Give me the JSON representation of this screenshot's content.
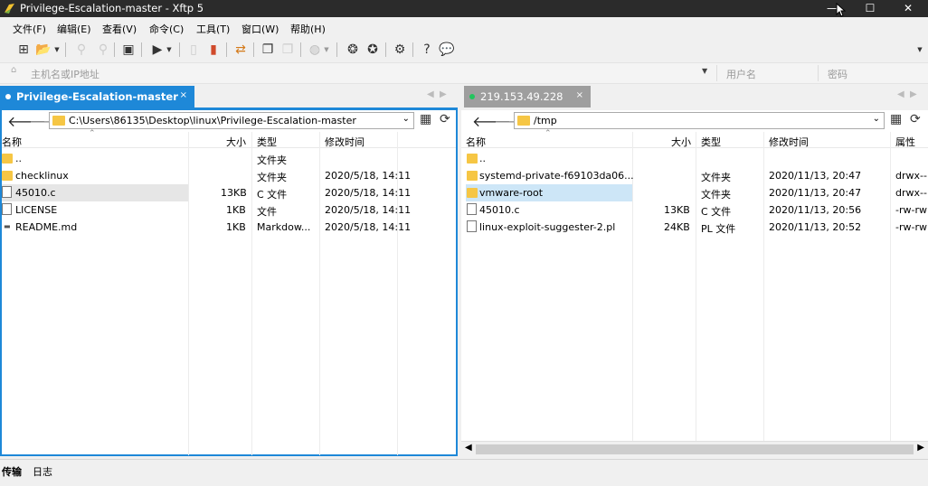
{
  "window": {
    "title": "Privilege-Escalation-master - Xftp 5"
  },
  "menu": [
    "文件(F)",
    "编辑(E)",
    "查看(V)",
    "命令(C)",
    "工具(T)",
    "窗口(W)",
    "帮助(H)"
  ],
  "address": {
    "host_placeholder": "主机名或IP地址",
    "user_placeholder": "用户名",
    "password_placeholder": "密码"
  },
  "tabs": {
    "local": {
      "label": "Privilege-Escalation-master",
      "close": "×"
    },
    "remote": {
      "label": "219.153.49.228",
      "close": "×"
    }
  },
  "local": {
    "path": "C:\\Users\\86135\\Desktop\\linux\\Privilege-Escalation-master",
    "columns": {
      "name": "名称",
      "size": "大小",
      "type": "类型",
      "modified": "修改时间"
    },
    "rows": [
      {
        "name": "..",
        "size": "",
        "type": "文件夹",
        "modified": "",
        "icon": "folder"
      },
      {
        "name": "checklinux",
        "size": "",
        "type": "文件夹",
        "modified": "2020/5/18, 14:11",
        "icon": "folder"
      },
      {
        "name": "45010.c",
        "size": "13KB",
        "type": "C 文件",
        "modified": "2020/5/18, 14:11",
        "icon": "file"
      },
      {
        "name": "LICENSE",
        "size": "1KB",
        "type": "文件",
        "modified": "2020/5/18, 14:11",
        "icon": "file"
      },
      {
        "name": "README.md",
        "size": "1KB",
        "type": "Markdow...",
        "modified": "2020/5/18, 14:11",
        "icon": "md"
      }
    ]
  },
  "remote": {
    "path": "/tmp",
    "columns": {
      "name": "名称",
      "size": "大小",
      "type": "类型",
      "modified": "修改时间",
      "attr": "属性"
    },
    "rows": [
      {
        "name": "..",
        "size": "",
        "type": "",
        "modified": "",
        "attr": "",
        "icon": "folder"
      },
      {
        "name": "systemd-private-f69103da06...",
        "size": "",
        "type": "文件夹",
        "modified": "2020/11/13, 20:47",
        "attr": "drwx--",
        "icon": "folder"
      },
      {
        "name": "vmware-root",
        "size": "",
        "type": "文件夹",
        "modified": "2020/11/13, 20:47",
        "attr": "drwx--",
        "icon": "folder"
      },
      {
        "name": "45010.c",
        "size": "13KB",
        "type": "C 文件",
        "modified": "2020/11/13, 20:56",
        "attr": "-rw-rw",
        "icon": "file"
      },
      {
        "name": "linux-exploit-suggester-2.pl",
        "size": "24KB",
        "type": "PL 文件",
        "modified": "2020/11/13, 20:52",
        "attr": "-rw-rw",
        "icon": "file"
      }
    ]
  },
  "bottom_tabs": [
    "传输",
    "日志"
  ]
}
